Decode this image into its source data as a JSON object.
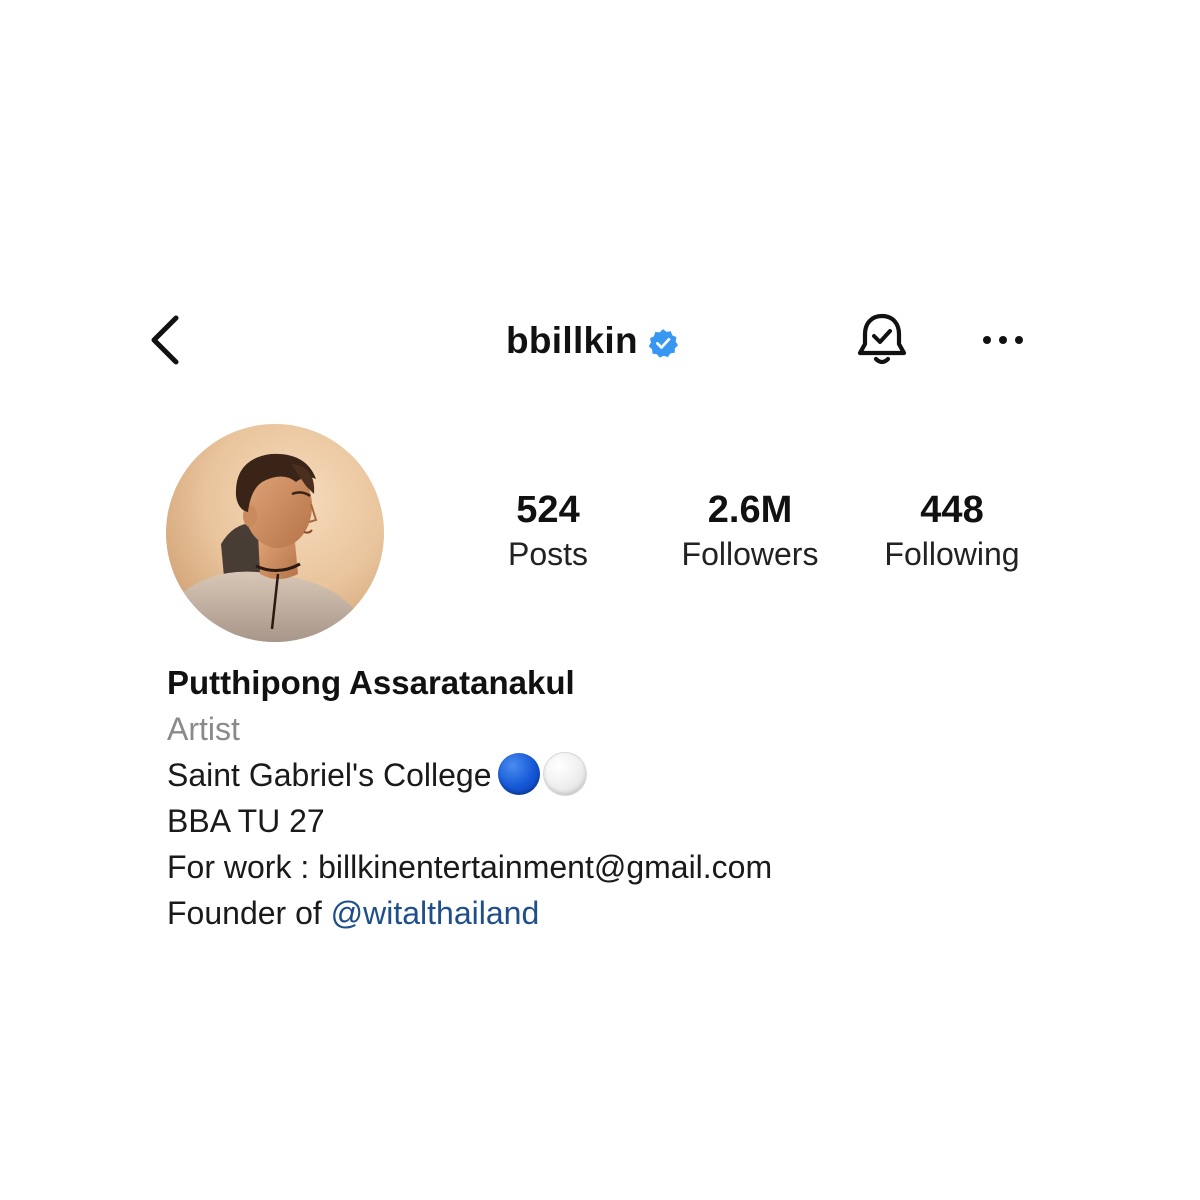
{
  "header": {
    "username": "bbillkin",
    "verified": true,
    "icons": {
      "back": "chevron-left-icon",
      "verified": "verified-badge-icon",
      "notifications": "bell-check-icon",
      "more": "more-horizontal-icon"
    },
    "verified_color": "#3897f0"
  },
  "stats": {
    "posts": {
      "value": "524",
      "label": "Posts"
    },
    "followers": {
      "value": "2.6M",
      "label": "Followers"
    },
    "following": {
      "value": "448",
      "label": "Following"
    }
  },
  "profile": {
    "full_name": "Putthipong Assaratanakul",
    "category": "Artist",
    "bio": {
      "line1": "Saint Gabriel's College",
      "line1_emoji": [
        "blue-circle",
        "white-circle"
      ],
      "line2": "BBA TU 27",
      "line3": "For work : billkinentertainment@gmail.com",
      "line4_prefix": "Founder of ",
      "line4_mention": "@witalthailand"
    }
  },
  "colors": {
    "mention": "#1e4f8a",
    "category": "#8a8a8a"
  }
}
